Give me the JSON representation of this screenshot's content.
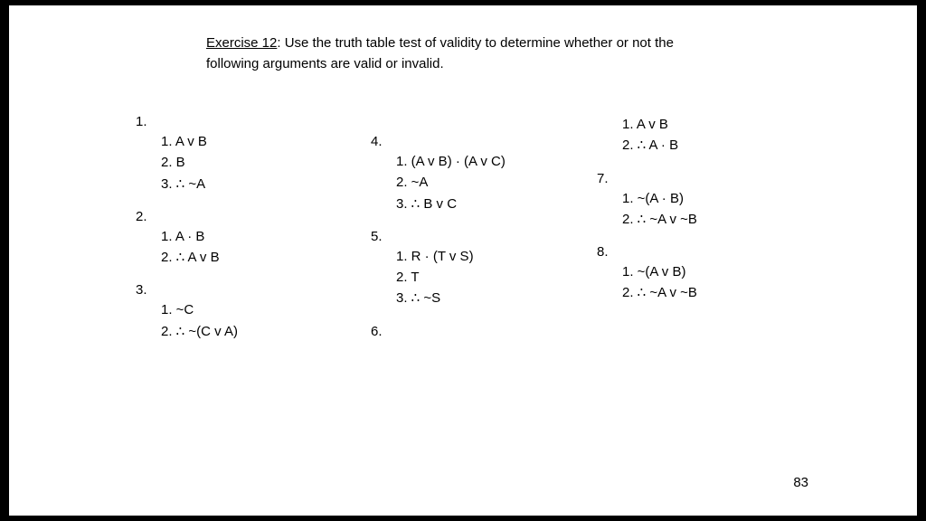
{
  "instruction": {
    "title": "Exercise 12",
    "text": ": Use the truth table test of validity to determine whether or not the following arguments are valid or invalid."
  },
  "columns": [
    {
      "problems": [
        {
          "head": "1.",
          "lines": [
            "1.  A v B",
            "2.  B",
            "3.  ∴  ~A"
          ]
        },
        {
          "head": "2.",
          "lines": [
            "1.  A · B",
            "2.  ∴  A v B"
          ]
        },
        {
          "head": "3.",
          "lines": [
            "1.  ~C",
            "2.  ∴  ~(C v A)"
          ]
        }
      ]
    },
    {
      "problems": [
        {
          "head": "4.",
          "lines": [
            "1.  (A v B) · (A v C)",
            "2.  ~A",
            "3.  ∴  B v C"
          ]
        },
        {
          "head": "5.",
          "lines": [
            "1.  R · (T v S)",
            "2.  T",
            "3.  ∴  ~S"
          ]
        },
        {
          "head": "6.",
          "lines": []
        }
      ]
    },
    {
      "problems": [
        {
          "head": "",
          "lines": [
            "1.  A v B",
            "2.  ∴  A · B"
          ]
        },
        {
          "head": "7.",
          "lines": [
            "1.  ~(A · B)",
            "2.  ∴  ~A v ~B"
          ]
        },
        {
          "head": "8.",
          "lines": [
            "1.  ~(A v B)",
            "2.  ∴  ~A v ~B"
          ]
        }
      ]
    }
  ],
  "page_number": "83"
}
